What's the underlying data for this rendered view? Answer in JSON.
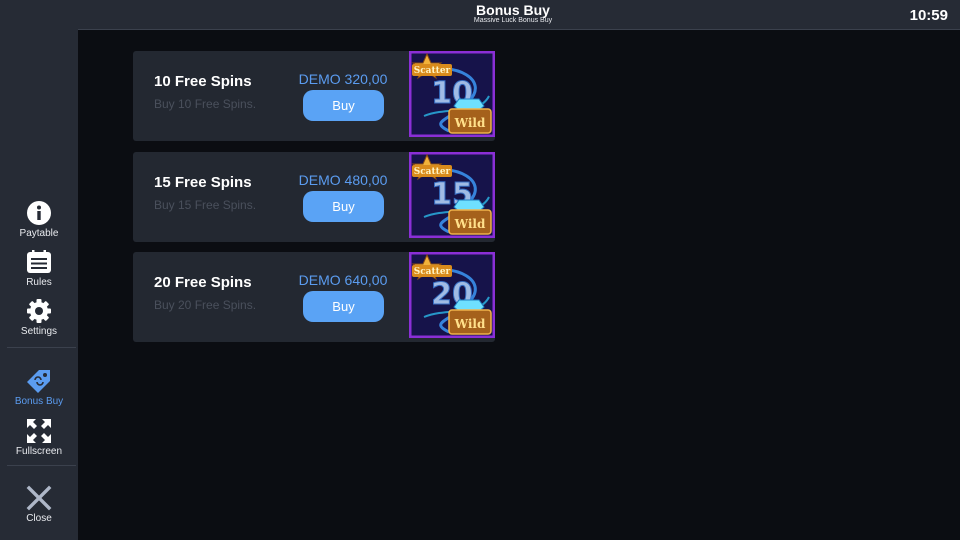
{
  "header": {
    "title": "Bonus Buy",
    "subtitle": "Massive Luck Bonus Buy",
    "clock": "10:59"
  },
  "sidebar": {
    "items": [
      {
        "label": "Paytable",
        "icon": "info-icon"
      },
      {
        "label": "Rules",
        "icon": "list-icon"
      },
      {
        "label": "Settings",
        "icon": "gear-icon"
      },
      {
        "label": "Bonus Buy",
        "icon": "tag-icon",
        "active": true
      },
      {
        "label": "Fullscreen",
        "icon": "expand-icon"
      },
      {
        "label": "Close",
        "icon": "close-icon"
      }
    ]
  },
  "offers": [
    {
      "name": "10 Free Spins",
      "description": "Buy 10 Free Spins.",
      "price": "DEMO 320,00",
      "buy_label": "Buy",
      "badge_number": "10",
      "badge_top": "Scatter",
      "badge_bottom": "Wild"
    },
    {
      "name": "15 Free Spins",
      "description": "Buy 15 Free Spins.",
      "price": "DEMO 480,00",
      "buy_label": "Buy",
      "badge_number": "15",
      "badge_top": "Scatter",
      "badge_bottom": "Wild"
    },
    {
      "name": "20 Free Spins",
      "description": "Buy 20 Free Spins.",
      "price": "DEMO 640,00",
      "buy_label": "Buy",
      "badge_number": "20",
      "badge_top": "Scatter",
      "badge_bottom": "Wild"
    }
  ],
  "colors": {
    "accent": "#5aa3f5",
    "active_nav": "#5b9cf0",
    "panel": "#262b35",
    "card": "#232831",
    "background": "#0b0d12"
  }
}
